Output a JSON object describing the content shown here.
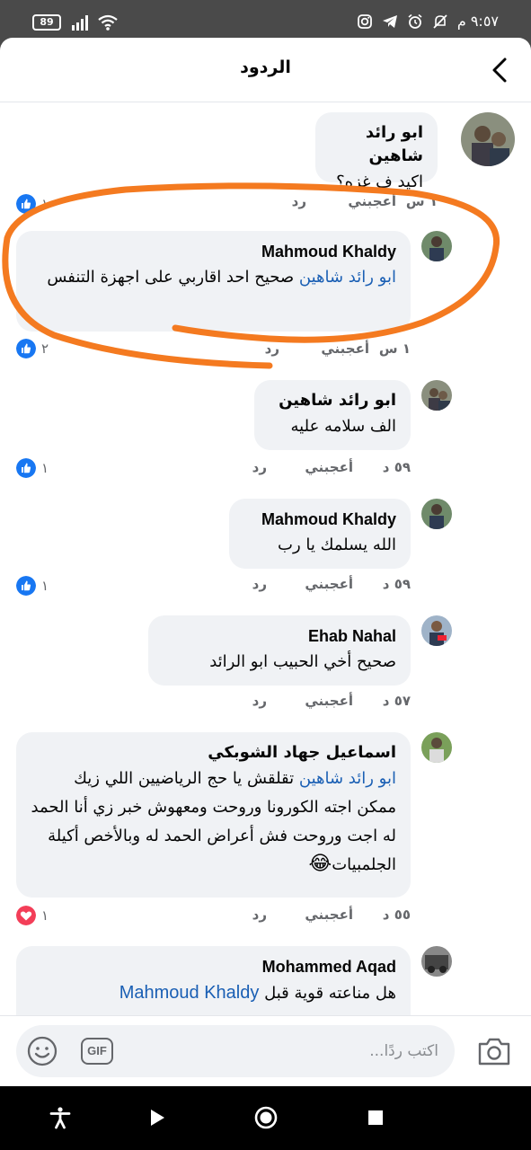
{
  "status_bar": {
    "time": "٩:٥٧ م",
    "battery": "89"
  },
  "header": {
    "title": "الردود"
  },
  "comments": [
    {
      "author": "ابو رائد شاهين",
      "text": "اكيد ف غزه؟",
      "time": "١ س",
      "like_label": "أعجبني",
      "reply_label": "رد",
      "reaction": "like",
      "reaction_count": "١"
    },
    {
      "author": "Mahmoud Khaldy",
      "mention": "ابو رائد شاهين",
      "text": " صحيح احد اقاربي على اجهزة التنفس",
      "time": "١ س",
      "like_label": "أعجبني",
      "reply_label": "رد",
      "reaction": "like",
      "reaction_count": "٢"
    },
    {
      "author": "ابو رائد شاهين",
      "text": "الف سلامه عليه",
      "time": "٥٩ د",
      "like_label": "أعجبني",
      "reply_label": "رد",
      "reaction": "like",
      "reaction_count": "١"
    },
    {
      "author": "Mahmoud Khaldy",
      "text": "الله يسلمك يا رب",
      "time": "٥٩ د",
      "like_label": "أعجبني",
      "reply_label": "رد",
      "reaction": "like",
      "reaction_count": "١"
    },
    {
      "author": "Ehab Nahal",
      "text": "صحيح أخي الحبيب ابو الرائد",
      "time": "٥٧ د",
      "like_label": "أعجبني",
      "reply_label": "رد"
    },
    {
      "author": "اسماعيل جهاد الشوبكي",
      "mention": "ابو رائد شاهين",
      "text": " تقلقش يا حج الرياضيين اللي زيك ممكن اجته الكورونا وروحت ومعهوش خبر زي أنا الحمد له اجت وروحت فش أعراض الحمد له وبالأخص أكيلة الجلمبيات",
      "emoji": "😂",
      "time": "٥٥ د",
      "like_label": "أعجبني",
      "reply_label": "رد",
      "reaction": "love",
      "reaction_count": "١"
    },
    {
      "author": "Mohammed Aqad",
      "mention": "Mahmoud Khaldy",
      "text_before": "هل مناعته قوية قبل "
    }
  ],
  "composer": {
    "placeholder": "اكتب ردًا...",
    "gif_label": "GIF"
  },
  "colors": {
    "like_blue": "#1877f2",
    "love_red": "#f33e58",
    "mention_blue": "#1a5fb4",
    "annotation_orange": "#f47a20"
  }
}
